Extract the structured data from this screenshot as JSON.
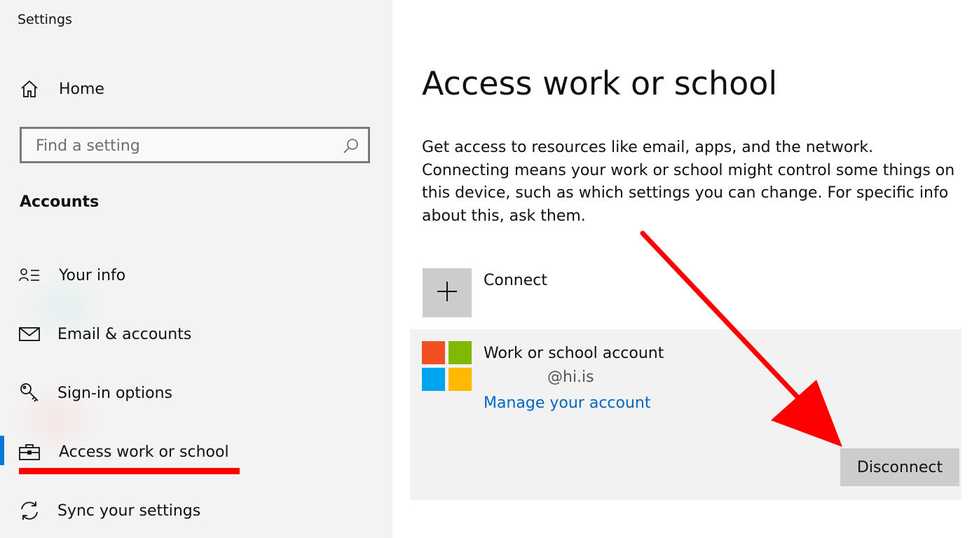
{
  "window": {
    "title": "Settings"
  },
  "sidebar": {
    "home_label": "Home",
    "search": {
      "placeholder": "Find a setting",
      "value": ""
    },
    "section_title": "Accounts",
    "items": [
      {
        "label": "Your info",
        "icon": "person-list-icon"
      },
      {
        "label": "Email & accounts",
        "icon": "mail-icon"
      },
      {
        "label": "Sign-in options",
        "icon": "key-icon"
      },
      {
        "label": "Access work or school",
        "icon": "briefcase-icon",
        "selected": true
      },
      {
        "label": "Sync your settings",
        "icon": "sync-icon"
      }
    ]
  },
  "main": {
    "title": "Access work or school",
    "description": "Get access to resources like email, apps, and the network. Connecting means your work or school might control some things on this device, such as which settings you can change. For specific info about this, ask them.",
    "connect_label": "Connect",
    "account": {
      "title": "Work or school account",
      "email": "@hi.is",
      "manage_link": "Manage your account",
      "disconnect_label": "Disconnect"
    }
  },
  "colors": {
    "accent": "#0078d7",
    "link": "#0067c0",
    "annotation": "#ff0000",
    "ms_logo": [
      "#f25022",
      "#7fba00",
      "#00a4ef",
      "#ffb900"
    ]
  }
}
